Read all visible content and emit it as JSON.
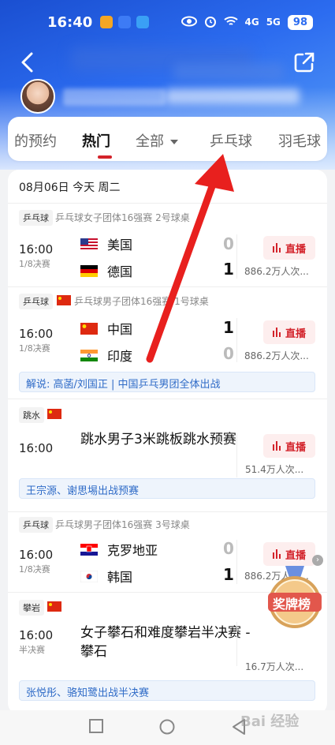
{
  "status_bar": {
    "time": "16:40",
    "battery": "98",
    "signal1": "4G",
    "signal2": "5G"
  },
  "tabs": [
    {
      "label": "的预约"
    },
    {
      "label": "热门"
    },
    {
      "label": "全部"
    },
    {
      "label": "乒乓球"
    },
    {
      "label": "羽毛球"
    }
  ],
  "active_tab": "热门",
  "date_row": "08月06日 今天 周二",
  "matches": [
    {
      "sport": "乒乓球",
      "event": "乒乓球女子团体16强赛 2号球桌",
      "time": "16:00",
      "stage": "1/8决赛",
      "team1": {
        "name": "美国",
        "flag": "usa-flag",
        "score": "0"
      },
      "team2": {
        "name": "德国",
        "flag": "germany-flag",
        "score": "1"
      },
      "live_label": "直播",
      "viewers": "886.2万人次..."
    },
    {
      "sport": "乒乓球",
      "event": "乒乓球男子团体16强赛 1号球桌",
      "time": "16:00",
      "stage": "1/8决赛",
      "team1": {
        "name": "中国",
        "flag": "china-flag",
        "score": "1"
      },
      "team2": {
        "name": "印度",
        "flag": "india-flag",
        "score": "0"
      },
      "live_label": "直播",
      "viewers": "886.2万人次...",
      "note": "解说: 高菡/刘国正 | 中国乒乓男团全体出战"
    },
    {
      "sport": "跳水",
      "time": "16:00",
      "title": "跳水男子3米跳板跳水预赛",
      "live_label": "直播",
      "viewers": "51.4万人次...",
      "note": "王宗源、谢思埸出战预赛"
    },
    {
      "sport": "乒乓球",
      "event": "乒乓球男子团体16强赛 3号球桌",
      "time": "16:00",
      "stage": "1/8决赛",
      "team1": {
        "name": "克罗地亚",
        "flag": "croatia-flag",
        "score": "0"
      },
      "team2": {
        "name": "韩国",
        "flag": "korea-flag",
        "score": "1"
      },
      "live_label": "直播",
      "viewers": "886.2万人次..."
    },
    {
      "sport": "攀岩",
      "time": "16:00",
      "stage": "半决赛",
      "title": "女子攀石和难度攀岩半决赛 - 攀石",
      "live_label": "直播",
      "viewers": "16.7万人次...",
      "note": "张悦彤、骆知鹭出战半决赛"
    }
  ],
  "medal_badge": "奖牌榜",
  "watermark": "Bai 经验",
  "colors": {
    "accent_red": "#d3222a",
    "header_blue": "#2c6cf0",
    "note_blue": "#2f6bc7"
  }
}
